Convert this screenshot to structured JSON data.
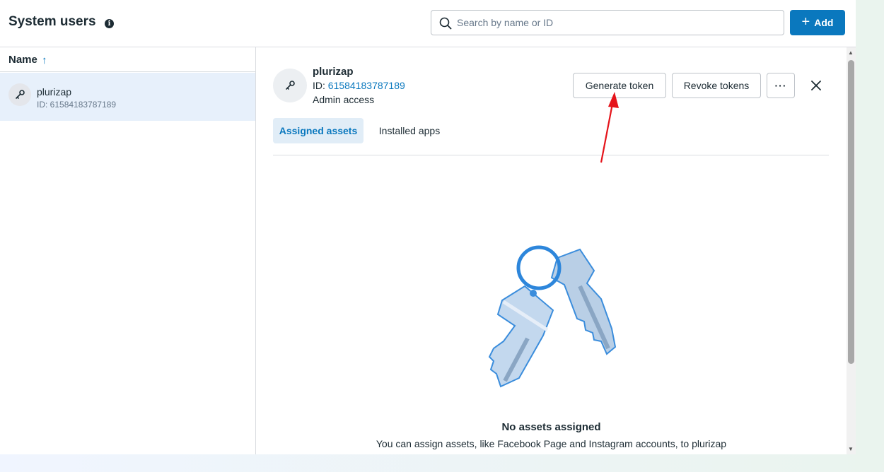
{
  "header": {
    "title": "System users",
    "info_icon": "info-icon",
    "search_placeholder": "Search by name or ID",
    "add_label": "Add"
  },
  "list": {
    "column_label": "Name",
    "sort_icon": "arrow-up-icon",
    "users": [
      {
        "name": "plurizap",
        "id_label": "ID: 61584183787189",
        "selected": true
      }
    ]
  },
  "detail": {
    "name": "plurizap",
    "id_prefix": "ID: ",
    "id_value": "61584183787189",
    "access": "Admin access",
    "buttons": {
      "generate": "Generate token",
      "revoke": "Revoke tokens",
      "more": "···"
    },
    "tabs": [
      {
        "label": "Assigned assets",
        "active": true
      },
      {
        "label": "Installed apps",
        "active": false
      }
    ],
    "empty_title": "No assets assigned",
    "empty_desc": "You can assign assets, like Facebook Page and Instagram accounts, to plurizap"
  },
  "colors": {
    "accent": "#0a78be",
    "annotation_arrow": "#e5141b"
  }
}
